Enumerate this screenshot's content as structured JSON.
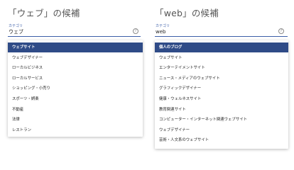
{
  "left": {
    "title": "「ウェブ」の候補",
    "field_label": "カテゴリ",
    "field_value": "ウェブ",
    "help_glyph": "?",
    "options": [
      {
        "label": "ウェブサイト",
        "selected": true
      },
      {
        "label": "ウェブデザイナー",
        "selected": false
      },
      {
        "label": "ローカルビジネス",
        "selected": false
      },
      {
        "label": "ローカルサービス",
        "selected": false
      },
      {
        "label": "ショッピング・小売り",
        "selected": false
      },
      {
        "label": "スポーツ・娯楽",
        "selected": false
      },
      {
        "label": "不動産",
        "selected": false
      },
      {
        "label": "法律",
        "selected": false
      },
      {
        "label": "レストラン",
        "selected": false
      }
    ]
  },
  "right": {
    "title": "「web」の候補",
    "field_label": "カテゴリ",
    "field_value": "web",
    "help_glyph": "?",
    "options": [
      {
        "label": "個人のブログ",
        "selected": true
      },
      {
        "label": "ウェブサイト",
        "selected": false
      },
      {
        "label": "エンターテイメントサイト",
        "selected": false
      },
      {
        "label": "ニュース・メディアのウェブサイト",
        "selected": false
      },
      {
        "label": "グラフィックデザイナー",
        "selected": false
      },
      {
        "label": "健康・ウェルネスサイト",
        "selected": false
      },
      {
        "label": "教育関連サイト",
        "selected": false
      },
      {
        "label": "コンピューター・インターネット関連ウェブサイト",
        "selected": false
      },
      {
        "label": "ウェブデザイナー",
        "selected": false
      },
      {
        "label": "芸術・人文系のウェブサイト",
        "selected": false
      }
    ]
  },
  "colors": {
    "accent": "#3b5da7",
    "selected_bg": "#2f4b87",
    "selected_text": "#ffffff",
    "title_text": "#555555"
  }
}
